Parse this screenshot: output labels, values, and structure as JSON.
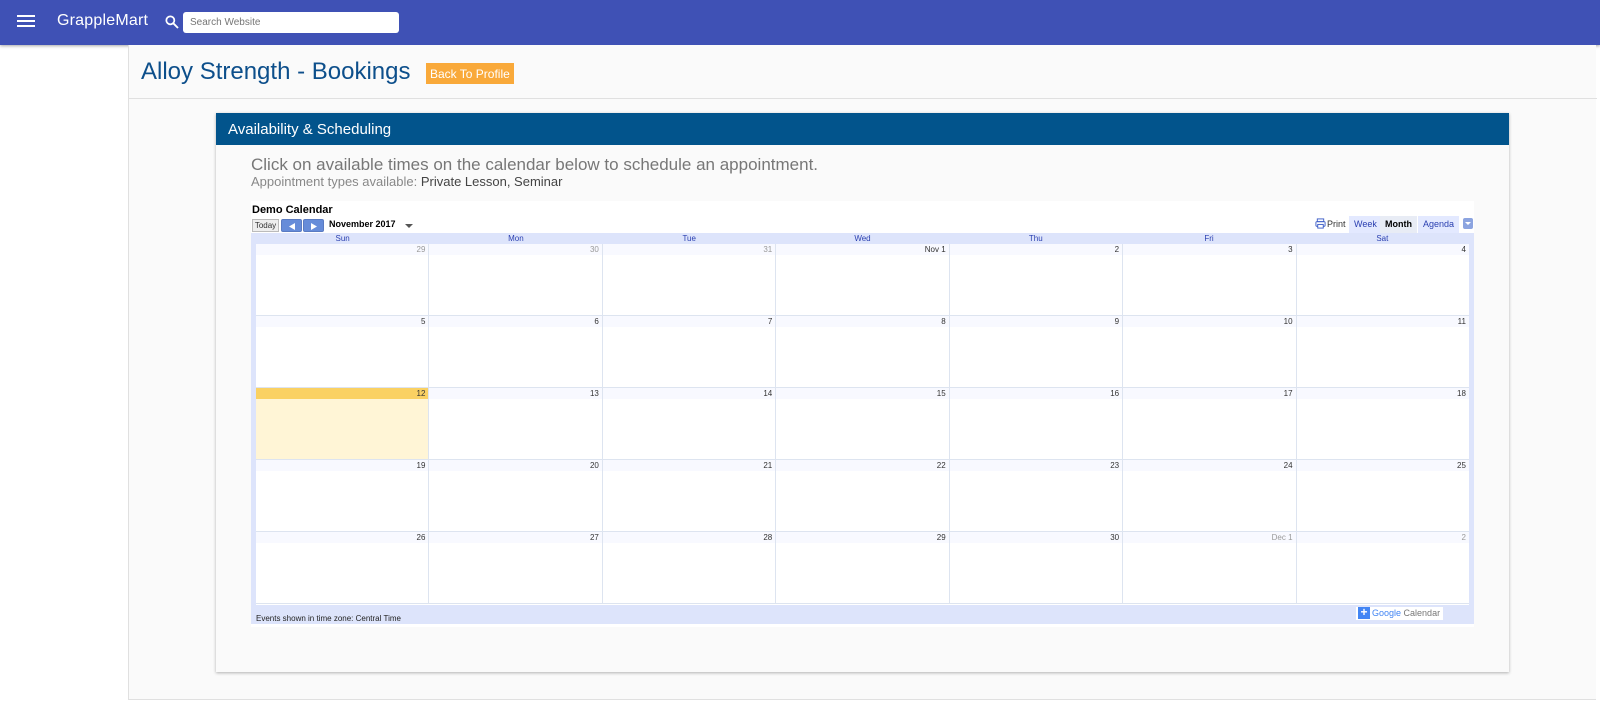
{
  "topbar": {
    "brand": "GrappleMart",
    "search_placeholder": "Search Website"
  },
  "page": {
    "title": "Alloy Strength - Bookings",
    "back_button": "Back To Profile"
  },
  "card": {
    "header": "Availability & Scheduling",
    "intro": "Click on available times on the calendar below to schedule an appointment.",
    "types_label": "Appointment types available:",
    "types": "Private Lesson, Seminar"
  },
  "calendar": {
    "title": "Demo Calendar",
    "today_label": "Today",
    "month": "November 2017",
    "print_label": "Print",
    "views": [
      "Week",
      "Month",
      "Agenda"
    ],
    "active_view": "Month",
    "days_of_week": [
      "Sun",
      "Mon",
      "Tue",
      "Wed",
      "Thu",
      "Fri",
      "Sat"
    ],
    "weeks": [
      [
        "29",
        "30",
        "31",
        "Nov 1",
        "2",
        "3",
        "4"
      ],
      [
        "5",
        "6",
        "7",
        "8",
        "9",
        "10",
        "11"
      ],
      [
        "12",
        "13",
        "14",
        "15",
        "16",
        "17",
        "18"
      ],
      [
        "19",
        "20",
        "21",
        "22",
        "23",
        "24",
        "25"
      ],
      [
        "26",
        "27",
        "28",
        "29",
        "30",
        "Dec 1",
        "2"
      ]
    ],
    "other_month": [
      [
        0,
        0
      ],
      [
        0,
        1
      ],
      [
        0,
        2
      ],
      [
        4,
        5
      ],
      [
        4,
        6
      ]
    ],
    "today_cell": [
      2,
      0
    ],
    "timezone_note": "Events shown in time zone: Central Time",
    "badge": {
      "google": "Google",
      "calendar": "Calendar"
    },
    "colors": {
      "today": "#fad163",
      "accent": "#2a3fb0"
    }
  }
}
